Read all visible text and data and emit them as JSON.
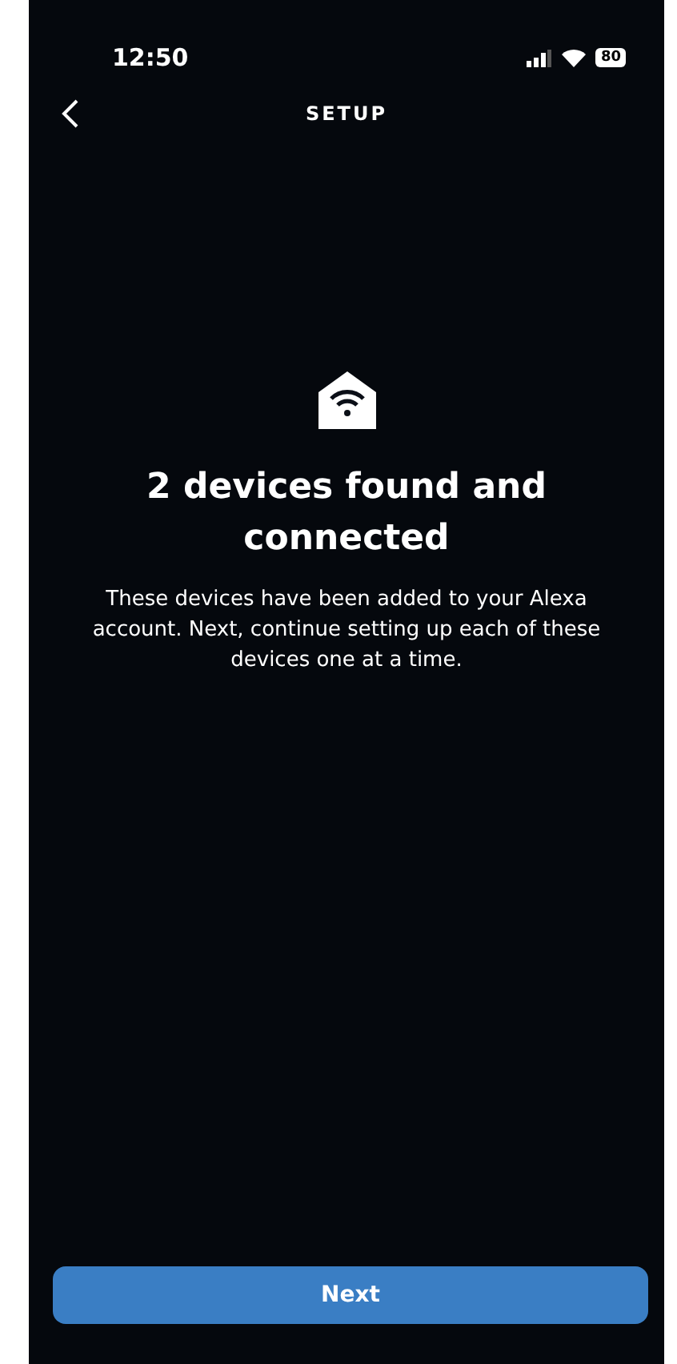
{
  "status_bar": {
    "time": "12:50",
    "battery": "80"
  },
  "header": {
    "title": "SETUP"
  },
  "title": "2 devices found and connected",
  "description": "These devices have been added to your Alexa account. Next, continue setting up each of these devices one at a time.",
  "buttons": [
    "Next"
  ]
}
